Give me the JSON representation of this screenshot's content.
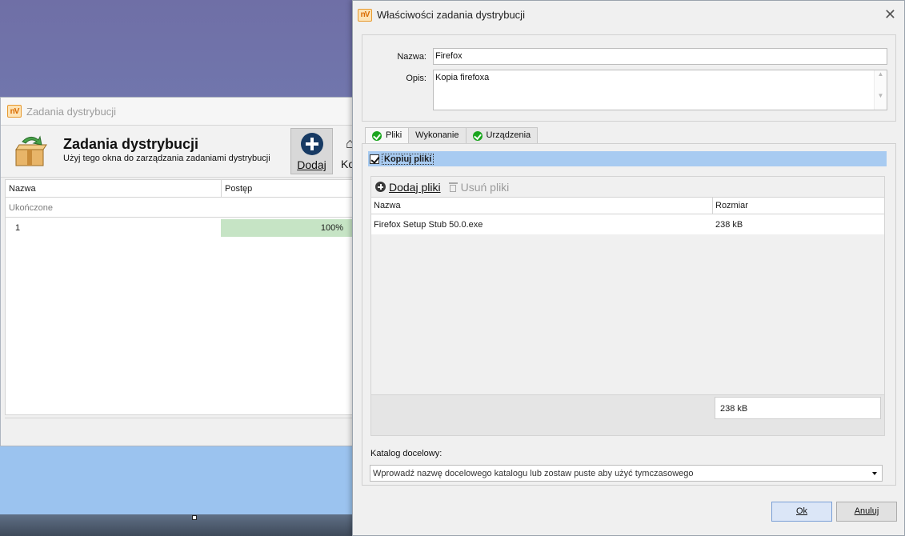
{
  "back_window": {
    "title": "Zadania dystrybucji",
    "header_title": "Zadania dystrybucji",
    "header_subtitle": "Użyj tego okna do zarządzania zadaniami dystrybucji",
    "add_button_label": "Dodaj",
    "next_button_label": "Ko",
    "columns": [
      "Nazwa",
      "Postęp"
    ],
    "group_label": "Ukończone",
    "rows": [
      {
        "name": "1",
        "progress_text": "100%",
        "progress": 1.0
      }
    ]
  },
  "dialog": {
    "app_icon_text": "nV",
    "title": "Właściwości zadania dystrybucji",
    "name_label": "Nazwa:",
    "name_value": "Firefox",
    "desc_label": "Opis:",
    "desc_value": "Kopia firefoxa",
    "tabs": [
      {
        "label": "Pliki",
        "icon": "check-circle-icon",
        "active": true
      },
      {
        "label": "Wykonanie",
        "icon": "",
        "active": false
      },
      {
        "label": "Urządzenia",
        "icon": "check-circle-icon",
        "active": false
      }
    ],
    "copy_files_label": "Kopiuj pliki",
    "copy_files_checked": true,
    "add_files_label": "Dodaj pliki",
    "remove_files_label": "Usuń pliki",
    "file_columns": [
      "Nazwa",
      "Rozmiar"
    ],
    "files": [
      {
        "name": "Firefox Setup Stub 50.0.exe",
        "size": "238 kB"
      }
    ],
    "total_size": "238 kB",
    "target_dir_label": "Katalog docelowy:",
    "target_dir_placeholder": "Wprowadź nazwę docelowego katalogu lub zostaw puste aby użyć tymczasowego",
    "ok_label": "Ok",
    "cancel_label": "Anuluj"
  },
  "colors": {
    "selection_bar": "#a8cbf1",
    "progress_fill": "#c6e4c5",
    "tab_check": "#1aa51e",
    "ok_button": "#dbe6f7"
  }
}
